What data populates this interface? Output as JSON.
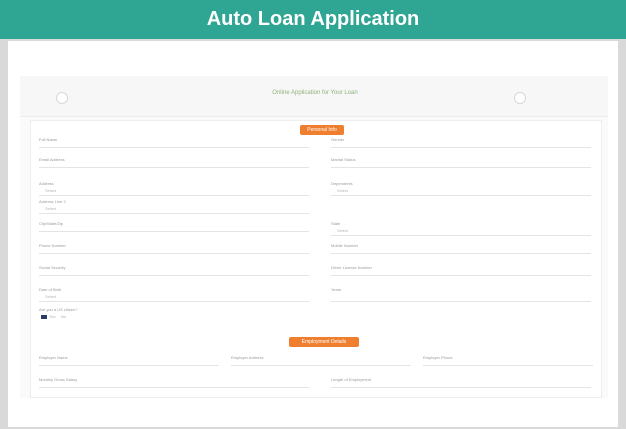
{
  "page": {
    "banner_title": "Auto Loan Application"
  },
  "form_preview": {
    "title": "Online Application for Your Loan",
    "section_1_button": "Personal Info",
    "section_2_button": "Employment Details",
    "labels_left": [
      "Full Name",
      "Email Address",
      "Address",
      "Address Line 2",
      "City/State/Zip",
      "Phone Number",
      "Social Security",
      "Date of Birth",
      "Are you a US citizen?"
    ],
    "labels_right": [
      "Gender",
      "Marital Status",
      "Dependents",
      "State",
      "Mobile Number",
      "Driver License Number",
      "Years"
    ],
    "values": [
      "Select",
      "Select",
      "Select",
      "Select",
      "Select",
      "Yes",
      "No"
    ],
    "employment_labels": [
      "Employer Name",
      "Employer Address",
      "Employer Phone",
      "Monthly Gross Salary",
      "Length of Employment"
    ]
  },
  "colors": {
    "banner": "#2fa594",
    "section_button": "#ef7f2f",
    "frame": "#d9d9d9"
  }
}
